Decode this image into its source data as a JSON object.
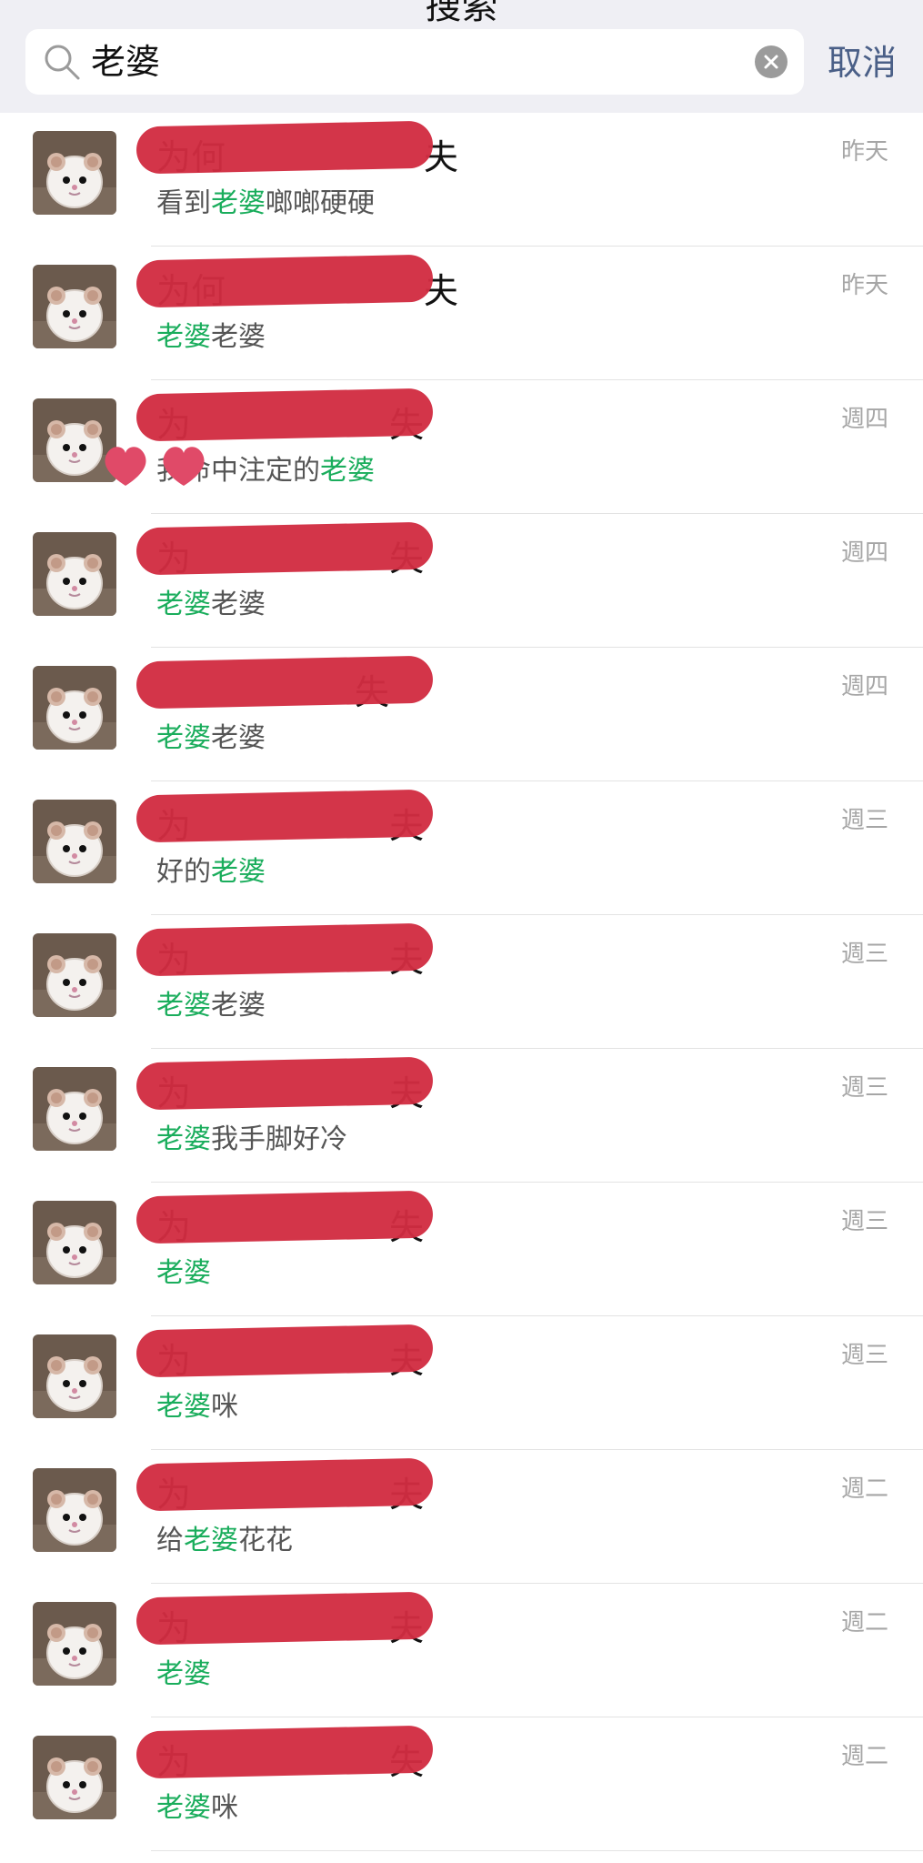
{
  "header": {
    "title": "搜索",
    "search_value": "老婆",
    "cancel_label": "取消"
  },
  "rows": [
    {
      "name": "为何",
      "suffix": "夫",
      "time": "昨天",
      "pre": "看到",
      "hl": "老婆",
      "post": "啷啷硬硬"
    },
    {
      "name": "为何",
      "suffix": "夫",
      "time": "昨天",
      "pre": "",
      "hl": "老婆",
      "post": "老婆"
    },
    {
      "name": "为",
      "suffix": "失",
      "time": "週四",
      "pre": "我命中注定的",
      "hl": "老婆",
      "post": ""
    },
    {
      "name": "为",
      "suffix": "失",
      "time": "週四",
      "pre": "",
      "hl": "老婆",
      "post": "老婆"
    },
    {
      "name": "",
      "suffix": "失",
      "time": "週四",
      "pre": "",
      "hl": "老婆",
      "post": "老婆"
    },
    {
      "name": "为",
      "suffix": "夫",
      "time": "週三",
      "pre": "好的",
      "hl": "老婆",
      "post": ""
    },
    {
      "name": "为",
      "suffix": "夫",
      "time": "週三",
      "pre": "",
      "hl": "老婆",
      "post": "老婆"
    },
    {
      "name": "为",
      "suffix": "夫",
      "time": "週三",
      "pre": "",
      "hl": "老婆",
      "post": "我手脚好冷"
    },
    {
      "name": "为",
      "suffix": "失",
      "time": "週三",
      "pre": "",
      "hl": "老婆",
      "post": ""
    },
    {
      "name": "为",
      "suffix": "夫",
      "time": "週三",
      "pre": "",
      "hl": "老婆",
      "post": "咪"
    },
    {
      "name": "为",
      "suffix": "夫",
      "time": "週二",
      "pre": "给",
      "hl": "老婆",
      "post": "花花"
    },
    {
      "name": "为",
      "suffix": "夫",
      "time": "週二",
      "pre": "",
      "hl": "老婆",
      "post": ""
    },
    {
      "name": "为",
      "suffix": "失",
      "time": "週二",
      "pre": "",
      "hl": "老婆",
      "post": "咪"
    }
  ],
  "colors": {
    "accent_highlight": "#1aad5c",
    "cancel": "#4a5f87",
    "redaction": "#d12d42",
    "background_top": "#efeff4"
  }
}
